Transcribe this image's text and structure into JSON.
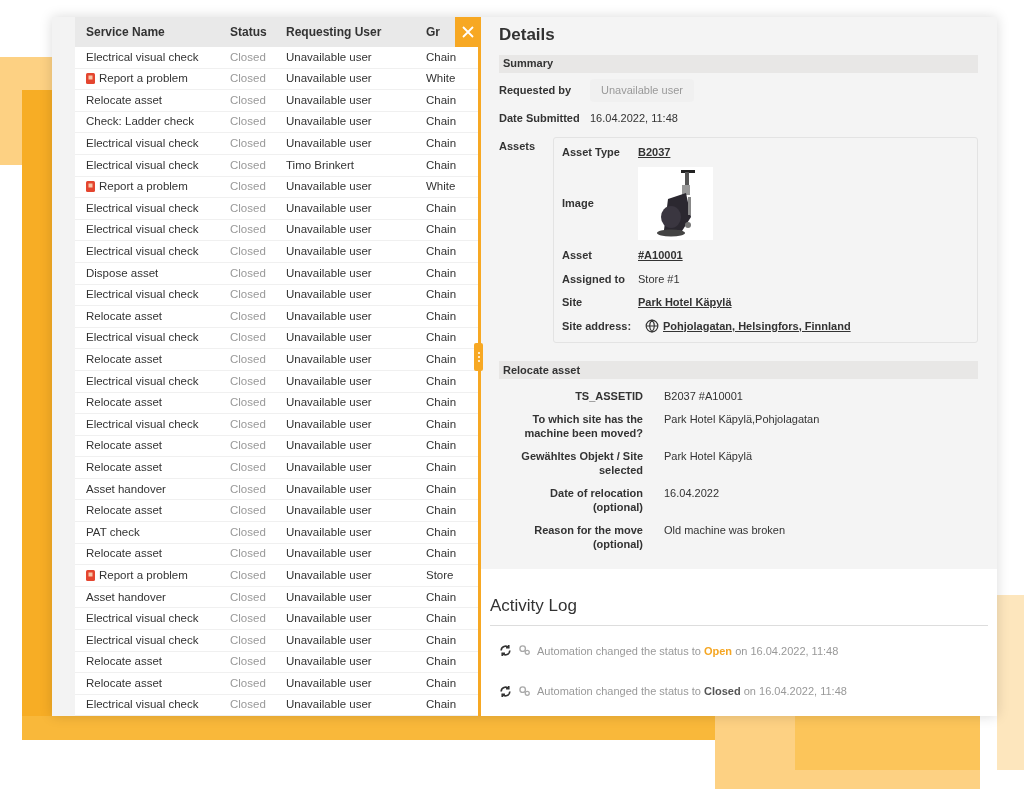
{
  "table": {
    "columns": [
      "Service Name",
      "Status",
      "Requesting User",
      "Gr"
    ],
    "rows": [
      {
        "kind": "plain",
        "service": "Electrical visual check",
        "status": "Closed",
        "user": "Unavailable user",
        "group": "Chain"
      },
      {
        "kind": "problem",
        "service": "Report a problem",
        "status": "Closed",
        "user": "Unavailable user",
        "group": "White"
      },
      {
        "kind": "plain",
        "service": "Relocate asset",
        "status": "Closed",
        "user": "Unavailable user",
        "group": "Chain"
      },
      {
        "kind": "plain",
        "service": "Check: Ladder check",
        "status": "Closed",
        "user": "Unavailable user",
        "group": "Chain"
      },
      {
        "kind": "plain",
        "service": "Electrical visual check",
        "status": "Closed",
        "user": "Unavailable user",
        "group": "Chain"
      },
      {
        "kind": "plain",
        "service": "Electrical visual check",
        "status": "Closed",
        "user": "Timo Brinkert",
        "group": "Chain"
      },
      {
        "kind": "problem",
        "service": "Report a problem",
        "status": "Closed",
        "user": "Unavailable user",
        "group": "White"
      },
      {
        "kind": "plain",
        "service": "Electrical visual check",
        "status": "Closed",
        "user": "Unavailable user",
        "group": "Chain"
      },
      {
        "kind": "plain",
        "service": "Electrical visual check",
        "status": "Closed",
        "user": "Unavailable user",
        "group": "Chain"
      },
      {
        "kind": "plain",
        "service": "Electrical visual check",
        "status": "Closed",
        "user": "Unavailable user",
        "group": "Chain"
      },
      {
        "kind": "plain",
        "service": "Dispose asset",
        "status": "Closed",
        "user": "Unavailable user",
        "group": "Chain"
      },
      {
        "kind": "plain",
        "service": "Electrical visual check",
        "status": "Closed",
        "user": "Unavailable user",
        "group": "Chain"
      },
      {
        "kind": "plain",
        "service": "Relocate asset",
        "status": "Closed",
        "user": "Unavailable user",
        "group": "Chain"
      },
      {
        "kind": "plain",
        "service": "Electrical visual check",
        "status": "Closed",
        "user": "Unavailable user",
        "group": "Chain"
      },
      {
        "kind": "plain",
        "service": "Relocate asset",
        "status": "Closed",
        "user": "Unavailable user",
        "group": "Chain"
      },
      {
        "kind": "plain",
        "service": "Electrical visual check",
        "status": "Closed",
        "user": "Unavailable user",
        "group": "Chain"
      },
      {
        "kind": "plain",
        "service": "Relocate asset",
        "status": "Closed",
        "user": "Unavailable user",
        "group": "Chain"
      },
      {
        "kind": "plain",
        "service": "Electrical visual check",
        "status": "Closed",
        "user": "Unavailable user",
        "group": "Chain"
      },
      {
        "kind": "plain",
        "service": "Relocate asset",
        "status": "Closed",
        "user": "Unavailable user",
        "group": "Chain"
      },
      {
        "kind": "plain",
        "service": "Relocate asset",
        "status": "Closed",
        "user": "Unavailable user",
        "group": "Chain"
      },
      {
        "kind": "plain",
        "service": "Asset handover",
        "status": "Closed",
        "user": "Unavailable user",
        "group": "Chain"
      },
      {
        "kind": "plain",
        "service": "Relocate asset",
        "status": "Closed",
        "user": "Unavailable user",
        "group": "Chain"
      },
      {
        "kind": "plain",
        "service": "PAT check",
        "status": "Closed",
        "user": "Unavailable user",
        "group": "Chain"
      },
      {
        "kind": "plain",
        "service": "Relocate asset",
        "status": "Closed",
        "user": "Unavailable user",
        "group": "Chain"
      },
      {
        "kind": "problem",
        "service": "Report a problem",
        "status": "Closed",
        "user": "Unavailable user",
        "group": "Store"
      },
      {
        "kind": "plain",
        "service": "Asset handover",
        "status": "Closed",
        "user": "Unavailable user",
        "group": "Chain"
      },
      {
        "kind": "plain",
        "service": "Electrical visual check",
        "status": "Closed",
        "user": "Unavailable user",
        "group": "Chain"
      },
      {
        "kind": "plain",
        "service": "Electrical visual check",
        "status": "Closed",
        "user": "Unavailable user",
        "group": "Chain"
      },
      {
        "kind": "plain",
        "service": "Relocate asset",
        "status": "Closed",
        "user": "Unavailable user",
        "group": "Chain"
      },
      {
        "kind": "plain",
        "service": "Relocate asset",
        "status": "Closed",
        "user": "Unavailable user",
        "group": "Chain"
      },
      {
        "kind": "plain",
        "service": "Electrical visual check",
        "status": "Closed",
        "user": "Unavailable user",
        "group": "Chain"
      }
    ]
  },
  "details": {
    "title": "Details",
    "summary": {
      "heading": "Summary",
      "fields": [
        {
          "label": "Requested by",
          "value": "Unavailable user",
          "kind": "chip"
        },
        {
          "label": "Date Submitted",
          "value": "16.04.2022, 11:48",
          "kind": "text"
        }
      ],
      "assets_label": "Assets",
      "asset_fields": [
        {
          "label": "Asset Type",
          "value": "B2037",
          "kind": "link"
        },
        {
          "label": "Image",
          "kind": "picture"
        },
        {
          "label": "Asset",
          "value": "#A10001",
          "kind": "link"
        },
        {
          "label": "Assigned to",
          "value": "Store #1",
          "kind": "text"
        },
        {
          "label": "Site",
          "value": "Park Hotel Käpylä",
          "kind": "link"
        },
        {
          "label": "Site address:",
          "value": "Pohjolagatan, Helsingfors, Finnland",
          "kind": "address"
        }
      ]
    },
    "relocate": {
      "heading": "Relocate asset",
      "fields": [
        {
          "label": "TS_ASSETID",
          "value": "B2037 #A10001"
        },
        {
          "label": "To which site has the machine been moved?",
          "value": "Park Hotel Käpylä,Pohjolagatan"
        },
        {
          "label": "Gewähltes Objekt / Site selected",
          "value": "Park Hotel Käpylä"
        },
        {
          "label": "Date of relocation (optional)",
          "value": "16.04.2022"
        },
        {
          "label": "Reason for the move (optional)",
          "value": "Old machine was broken"
        }
      ]
    }
  },
  "activity_log": {
    "title": "Activity Log",
    "entries": [
      {
        "actor": "Automation",
        "text": "changed the status to",
        "status": "Open",
        "color": "#f5a623",
        "when": "on 16.04.2022, 11:48"
      },
      {
        "actor": "Automation",
        "text": "changed the status to",
        "status": "Closed",
        "color": "#555555",
        "when": "on 16.04.2022, 11:48"
      }
    ]
  }
}
